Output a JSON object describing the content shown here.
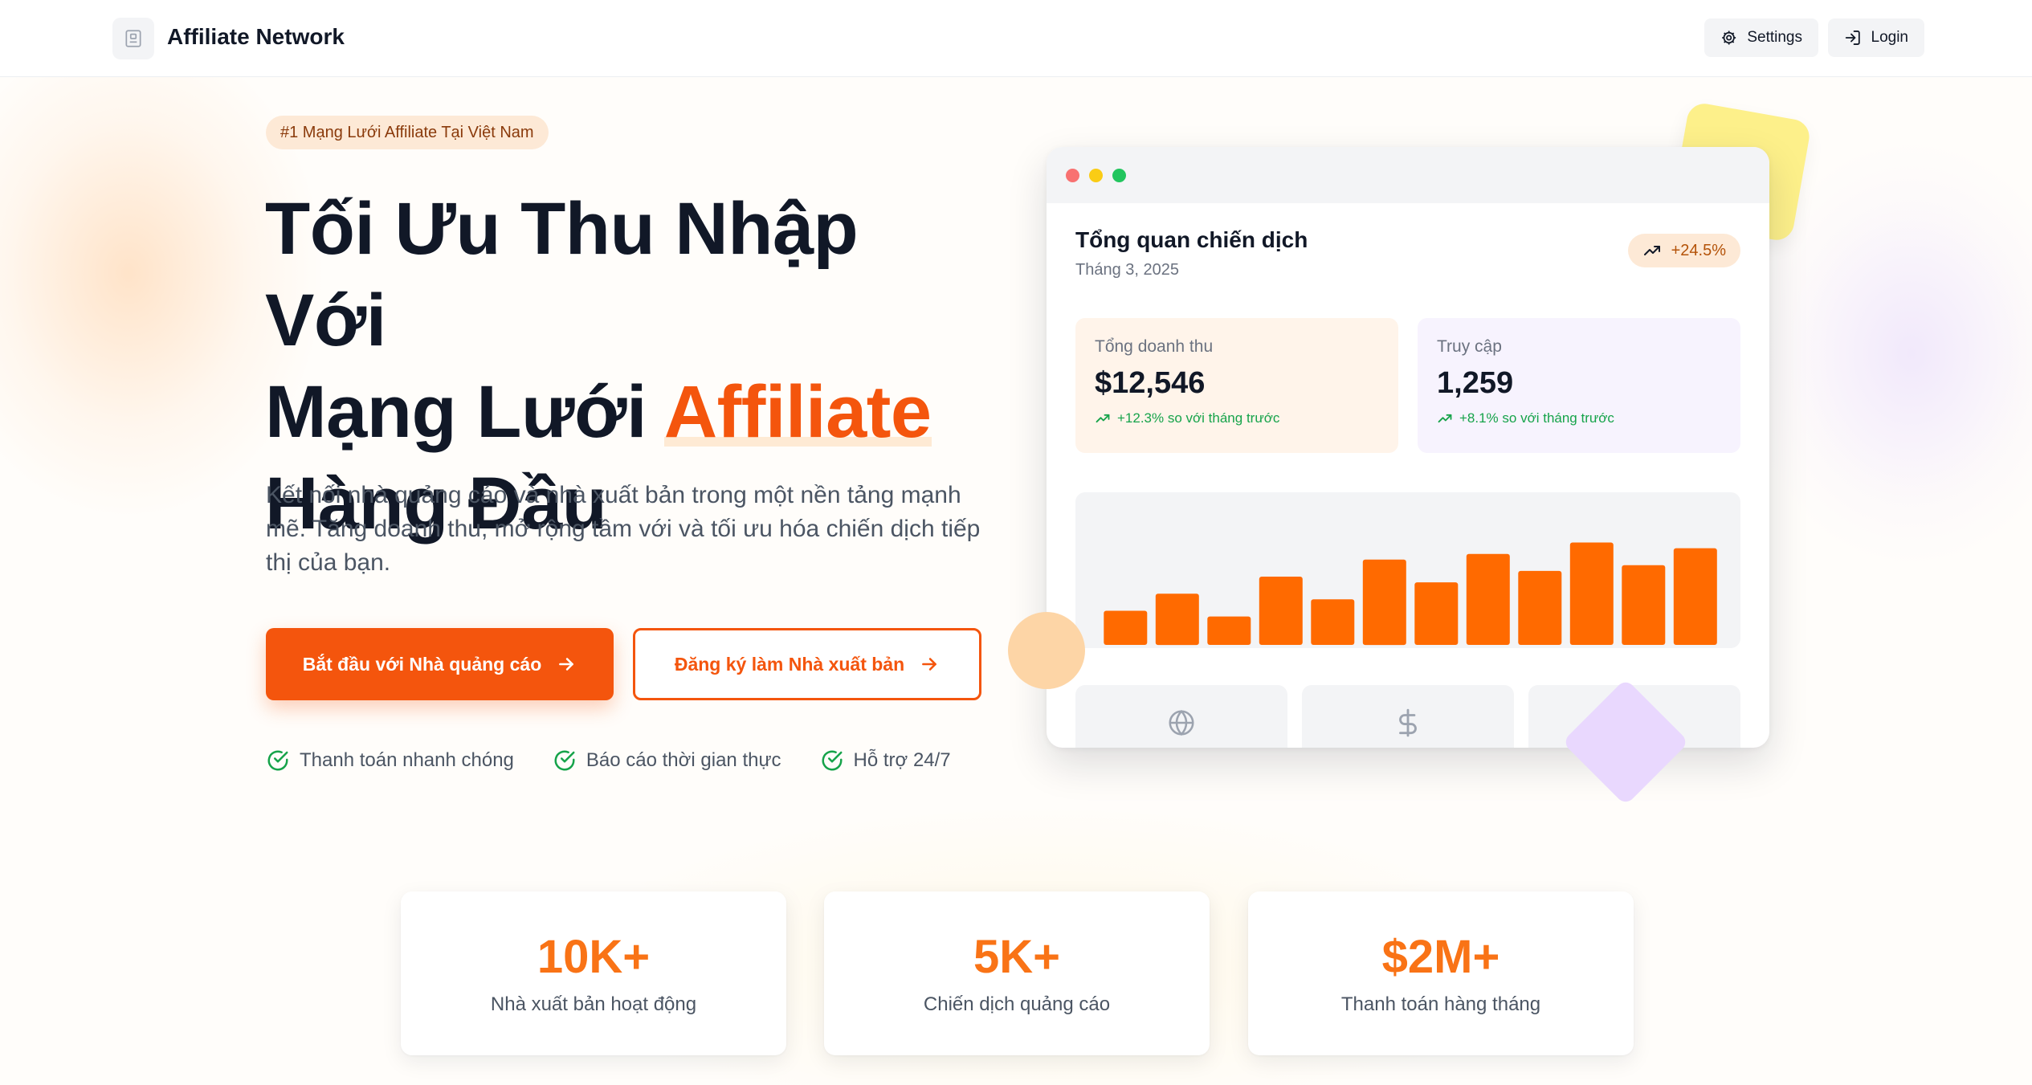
{
  "header": {
    "brand": "Affiliate Network",
    "settings_label": "Settings",
    "login_label": "Login"
  },
  "hero": {
    "badge": "#1 Mạng Lưới Affiliate Tại Việt Nam",
    "title_line1": "Tối Ưu Thu Nhập Với",
    "title_line2_prefix": "Mạng Lưới ",
    "title_line2_accent": "Affiliate",
    "title_line3": "Hàng Đầu",
    "description": "Kết nối nhà quảng cáo và nhà xuất bản trong một nền tảng mạnh mẽ. Tăng doanh thu, mở rộng tầm với và tối ưu hóa chiến dịch tiếp thị của bạn.",
    "cta_primary": "Bắt đầu với Nhà quảng cáo",
    "cta_secondary": "Đăng ký làm Nhà xuất bản",
    "features": [
      "Thanh toán nhanh chóng",
      "Báo cáo thời gian thực",
      "Hỗ trợ 24/7"
    ]
  },
  "dashboard": {
    "title": "Tổng quan chiến dịch",
    "subtitle": "Tháng 3, 2025",
    "growth": "+24.5%",
    "revenue": {
      "label": "Tổng doanh thu",
      "value": "$12,546",
      "change": "+12.3% so với tháng trước"
    },
    "traffic": {
      "label": "Truy cập",
      "value": "1,259",
      "change": "+8.1% so với tháng trước"
    }
  },
  "chart_data": {
    "type": "bar",
    "values": [
      30,
      45,
      25,
      60,
      40,
      75,
      55,
      80,
      65,
      90,
      70,
      85
    ],
    "ylim": [
      0,
      120
    ],
    "color": "#ff6a00"
  },
  "stats": [
    {
      "value": "10K+",
      "label": "Nhà xuất bản hoạt động"
    },
    {
      "value": "5K+",
      "label": "Chiến dịch quảng cáo"
    },
    {
      "value": "$2M+",
      "label": "Thanh toán hàng tháng"
    }
  ],
  "colors": {
    "accent": "#f4550d",
    "bar": "#ff6a00",
    "success": "#16a34a"
  },
  "icons": {
    "logo": "building-icon",
    "settings": "gear-icon",
    "login": "login-icon",
    "arrow": "arrow-right-icon",
    "check": "check-circle-icon",
    "trend": "trending-up-icon",
    "globe": "globe-icon",
    "dollar": "dollar-icon"
  }
}
